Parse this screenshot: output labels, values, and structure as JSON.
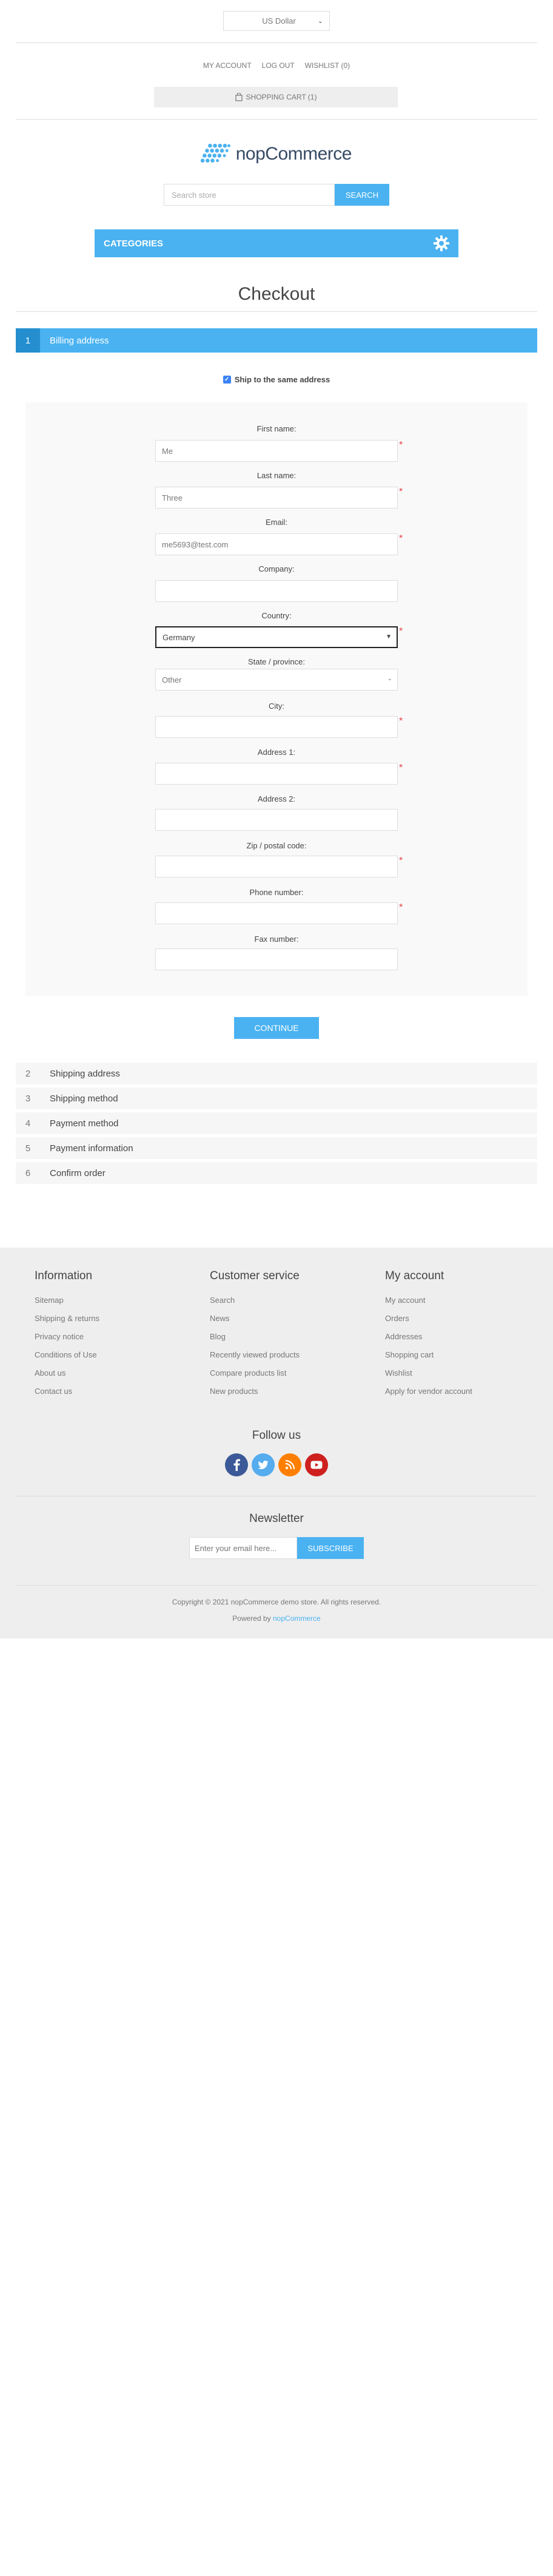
{
  "header": {
    "currency": "US Dollar",
    "links": [
      "My account",
      "Log out",
      "Wishlist (0)"
    ],
    "cart": "Shopping cart (1)",
    "logo": {
      "part1": "nop",
      "part2": "Commerce"
    },
    "search": {
      "placeholder": "Search store",
      "button": "Search"
    },
    "categories": "Categories"
  },
  "page": {
    "title": "Checkout"
  },
  "billing": {
    "step_number": "1",
    "step_label": "Billing address",
    "ship_same": "Ship to the same address",
    "fields": [
      {
        "label": "First name:",
        "value": "Me",
        "required": true
      },
      {
        "label": "Last name:",
        "value": "Three",
        "required": true
      },
      {
        "label": "Email:",
        "value": "me5693@test.com",
        "required": true
      },
      {
        "label": "Company:",
        "value": "",
        "required": false
      },
      {
        "label": "Country:",
        "value": "Germany",
        "required": true,
        "select": true
      },
      {
        "label": "State / province:",
        "value": "Other",
        "required": false,
        "select": true
      },
      {
        "label": "City:",
        "value": "",
        "required": true
      },
      {
        "label": "Address 1:",
        "value": "",
        "required": true
      },
      {
        "label": "Address 2:",
        "value": "",
        "required": false
      },
      {
        "label": "Zip / postal code:",
        "value": "",
        "required": true
      },
      {
        "label": "Phone number:",
        "value": "",
        "required": true
      },
      {
        "label": "Fax number:",
        "value": "",
        "required": false
      }
    ],
    "required_marker": "*",
    "continue": "Continue"
  },
  "steps": [
    {
      "num": "2",
      "label": "Shipping address"
    },
    {
      "num": "3",
      "label": "Shipping method"
    },
    {
      "num": "4",
      "label": "Payment method"
    },
    {
      "num": "5",
      "label": "Payment information"
    },
    {
      "num": "6",
      "label": "Confirm order"
    }
  ],
  "footer": {
    "columns": [
      {
        "title": "Information",
        "links": [
          "Sitemap",
          "Shipping & returns",
          "Privacy notice",
          "Conditions of Use",
          "About us",
          "Contact us"
        ]
      },
      {
        "title": "Customer service",
        "links": [
          "Search",
          "News",
          "Blog",
          "Recently viewed products",
          "Compare products list",
          "New products"
        ]
      },
      {
        "title": "My account",
        "links": [
          "My account",
          "Orders",
          "Addresses",
          "Shopping cart",
          "Wishlist",
          "Apply for vendor account"
        ]
      }
    ],
    "follow_title": "Follow us",
    "social": [
      {
        "name": "facebook-icon",
        "glyph": "f",
        "color": "#3b5998"
      },
      {
        "name": "twitter-icon",
        "glyph": "t",
        "color": "#55acee"
      },
      {
        "name": "rss-icon",
        "glyph": "r",
        "color": "#fe7f00"
      },
      {
        "name": "youtube-icon",
        "glyph": "▶",
        "color": "#cd201f"
      }
    ],
    "newsletter_title": "Newsletter",
    "newsletter_placeholder": "Enter your email here...",
    "newsletter_button": "Subscribe",
    "copyright": "Copyright © 2021 nopCommerce demo store. All rights reserved.",
    "powered_prefix": "Powered by",
    "powered_link": "nopCommerce"
  },
  "colors": {
    "accent": "#4ab2f1",
    "accent_dark": "#248ece",
    "required": "#e4434b"
  }
}
